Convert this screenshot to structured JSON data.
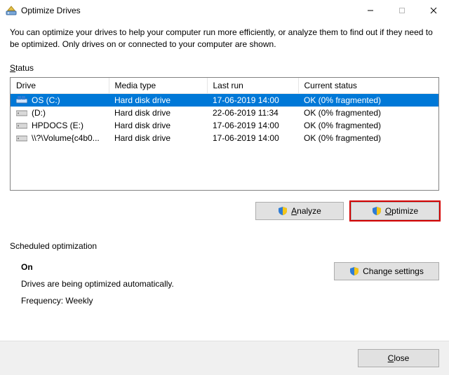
{
  "window": {
    "title": "Optimize Drives"
  },
  "description": "You can optimize your drives to help your computer run more efficiently, or analyze them to find out if they need to be optimized. Only drives on or connected to your computer are shown.",
  "status_label": "Status",
  "columns": {
    "drive": "Drive",
    "media": "Media type",
    "lastrun": "Last run",
    "status": "Current status"
  },
  "drives": [
    {
      "name": "OS (C:)",
      "media": "Hard disk drive",
      "lastrun": "17-06-2019 14:00",
      "status": "OK (0% fragmented)",
      "selected": true,
      "icon": "os"
    },
    {
      "name": "(D:)",
      "media": "Hard disk drive",
      "lastrun": "22-06-2019 11:34",
      "status": "OK (0% fragmented)",
      "selected": false,
      "icon": "hdd"
    },
    {
      "name": "HPDOCS (E:)",
      "media": "Hard disk drive",
      "lastrun": "17-06-2019 14:00",
      "status": "OK (0% fragmented)",
      "selected": false,
      "icon": "hdd"
    },
    {
      "name": "\\\\?\\Volume{c4b0...",
      "media": "Hard disk drive",
      "lastrun": "17-06-2019 14:00",
      "status": "OK (0% fragmented)",
      "selected": false,
      "icon": "hdd"
    }
  ],
  "buttons": {
    "analyze": "Analyze",
    "optimize": "Optimize",
    "change_settings": "Change settings",
    "close": "Close"
  },
  "scheduled": {
    "label": "Scheduled optimization",
    "state": "On",
    "desc": "Drives are being optimized automatically.",
    "frequency": "Frequency: Weekly"
  }
}
